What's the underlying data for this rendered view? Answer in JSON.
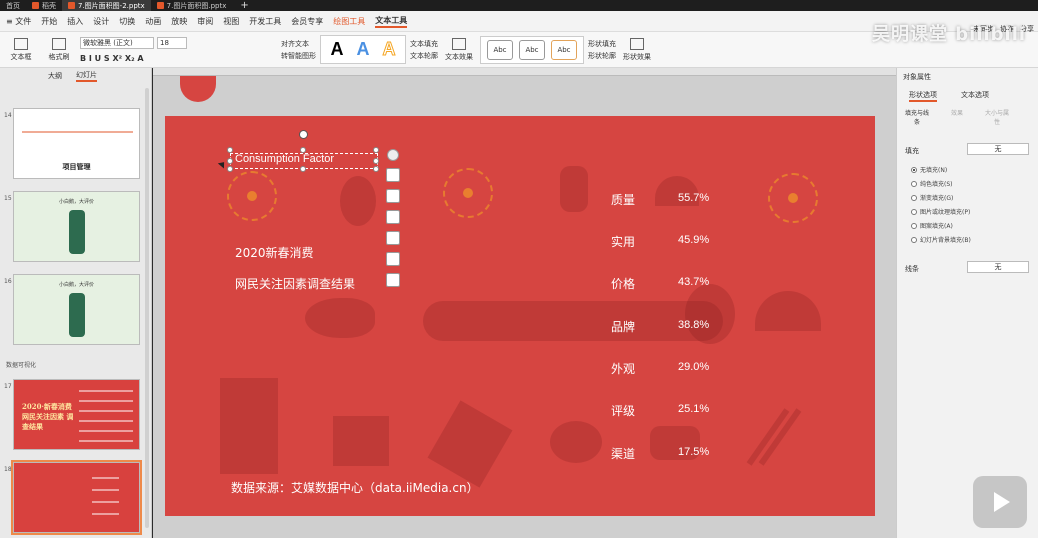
{
  "titlebar": {
    "tabs": [
      {
        "label": "首页"
      },
      {
        "label": "稻壳"
      },
      {
        "label": "7.图片面积图-2.pptx"
      },
      {
        "label": "7.图片面积图.pptx"
      }
    ],
    "new_tab": "+"
  },
  "menubar": {
    "file": "≡ 文件",
    "items": [
      "开始",
      "插入",
      "设计",
      "切换",
      "动画",
      "放映",
      "审阅",
      "视图",
      "开发工具",
      "会员专享",
      "绘图工具",
      "文本工具"
    ],
    "window": [
      "未同步",
      "协作",
      "分享"
    ]
  },
  "ribbon": {
    "textbox": "文本框",
    "format_painter": "格式刷",
    "font": "微软雅黑 (正文)",
    "size": "18",
    "format_row": "B  I  U  S  X²  X₂  A",
    "align_text": "对齐文本",
    "convert_smart": "转智能图形",
    "text_fill": "文本填充",
    "text_outline": "文本轮廓",
    "text_effect": "文本效果",
    "style_abc": "Abc",
    "shape_fill": "形状填充",
    "shape_outline": "形状轮廓",
    "shape_effect": "形状效果"
  },
  "left_panel": {
    "tabs": [
      "大纲",
      "幻灯片"
    ],
    "section_label": "数据可视化",
    "slides": [
      {
        "num": "14",
        "title": "项目管理"
      },
      {
        "num": "15",
        "heading": "小白鹅，大评价"
      },
      {
        "num": "16",
        "heading": "小白鹅，大评价"
      },
      {
        "num": "17",
        "title": "2020·新春消费 网民关注因素 调查结果"
      },
      {
        "num": "18"
      }
    ]
  },
  "slide": {
    "title": "Consumption Factor",
    "subtitle_1": "2020新春消费",
    "subtitle_2": "网民关注因素调查结果",
    "source": "数据来源：艾媒数据中心（data.iiMedia.cn）",
    "stats": [
      {
        "name": "质量",
        "value": "55.7%"
      },
      {
        "name": "实用",
        "value": "45.9%"
      },
      {
        "name": "价格",
        "value": "43.7%"
      },
      {
        "name": "品牌",
        "value": "38.8%"
      },
      {
        "name": "外观",
        "value": "29.0%"
      },
      {
        "name": "评级",
        "value": "25.1%"
      },
      {
        "name": "渠道",
        "value": "17.5%"
      }
    ]
  },
  "right_panel": {
    "title": "对象属性",
    "tabs": [
      "形状选项",
      "文本选项"
    ],
    "icon_tabs": [
      "填充与线条",
      "效果",
      "大小与属性"
    ],
    "fill_label": "填充",
    "fill_value": "无",
    "fill_options": [
      "无填充(N)",
      "纯色填充(S)",
      "渐变填充(G)",
      "图片或纹理填充(P)",
      "图案填充(A)",
      "幻灯片背景填充(B)"
    ],
    "line_label": "线条",
    "line_value": "无"
  },
  "watermark": "吴明课堂 bilibili",
  "colors": {
    "slide_bg": "#d64541",
    "accent": "#e2582b"
  }
}
